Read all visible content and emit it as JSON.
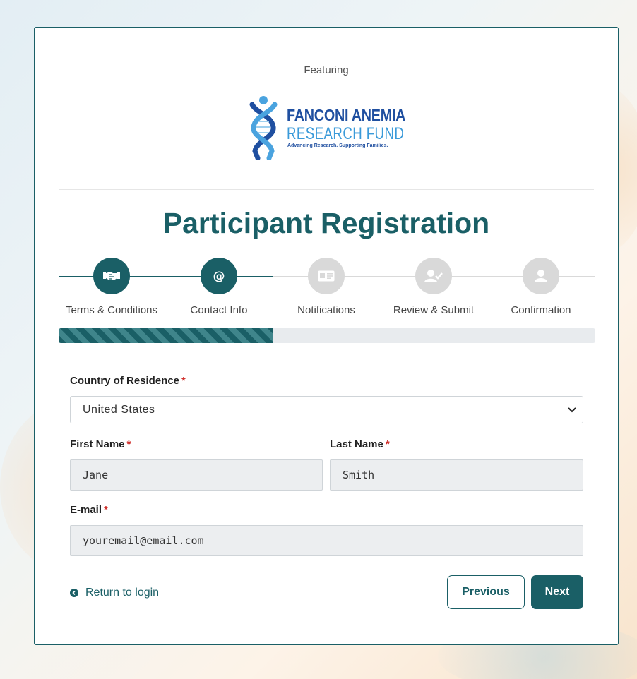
{
  "header": {
    "featuring": "Featuring",
    "logo": {
      "title": "FANCONI ANEMIA",
      "subtitle": "RESEARCH FUND",
      "tagline": "Advancing Research. Supporting Families."
    }
  },
  "page_title": "Participant Registration",
  "steps": [
    {
      "label": "Terms & Conditions",
      "icon": "handshake-icon",
      "state": "complete"
    },
    {
      "label": "Contact Info",
      "icon": "at-sign-icon",
      "state": "current"
    },
    {
      "label": "Notifications",
      "icon": "id-card-icon",
      "state": "pending"
    },
    {
      "label": "Review & Submit",
      "icon": "user-check-icon",
      "state": "pending"
    },
    {
      "label": "Confirmation",
      "icon": "user-icon",
      "state": "pending"
    }
  ],
  "progress": {
    "fraction": 0.4
  },
  "form": {
    "country": {
      "label": "Country of Residence",
      "required": "*",
      "value": "United States"
    },
    "first_name": {
      "label": "First Name",
      "required": "*",
      "placeholder": "Jane"
    },
    "last_name": {
      "label": "Last Name",
      "required": "*",
      "placeholder": "Smith"
    },
    "email": {
      "label": "E-mail",
      "required": "*",
      "placeholder": "youremail@email.com"
    }
  },
  "actions": {
    "return_label": "Return to login",
    "previous_label": "Previous",
    "next_label": "Next"
  },
  "colors": {
    "brand_teal": "#1a5f66",
    "inactive_gray": "#d9d9d9",
    "required_red": "#d0312d"
  }
}
